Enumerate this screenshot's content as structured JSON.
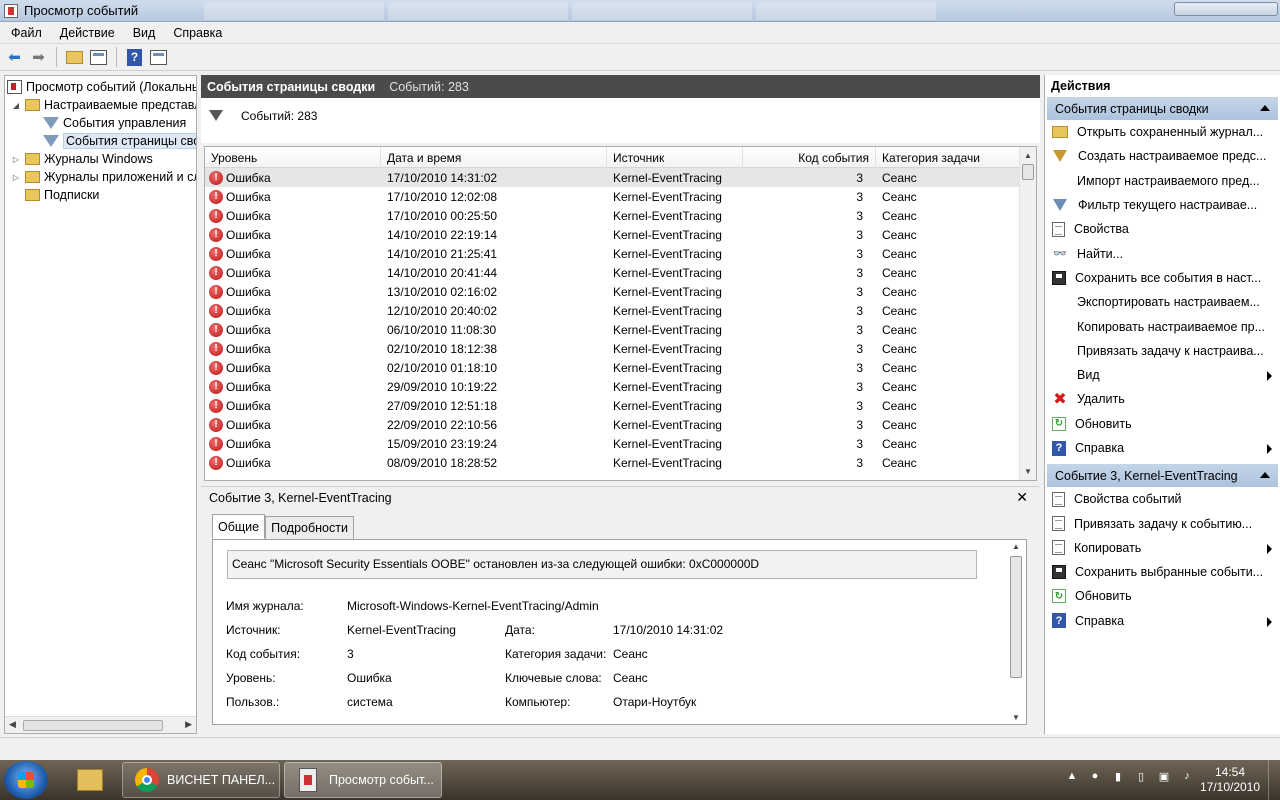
{
  "window": {
    "title": "Просмотр событий"
  },
  "menu": [
    "Файл",
    "Действие",
    "Вид",
    "Справка"
  ],
  "tree": {
    "items": [
      {
        "label": "Просмотр событий (Локальный)",
        "indent": 0,
        "icon": "event-viewer-icon",
        "expander": ""
      },
      {
        "label": "Настраиваемые представления",
        "indent": 1,
        "icon": "folder-icon",
        "expander": "◢"
      },
      {
        "label": "События управления",
        "indent": 2,
        "icon": "filter-icon",
        "expander": ""
      },
      {
        "label": "События страницы сводки",
        "indent": 2,
        "icon": "filter-icon",
        "expander": "",
        "selected": true
      },
      {
        "label": "Журналы Windows",
        "indent": 1,
        "icon": "folder-icon",
        "expander": "▷"
      },
      {
        "label": "Журналы приложений и служб",
        "indent": 1,
        "icon": "folder-icon",
        "expander": "▷"
      },
      {
        "label": "Подписки",
        "indent": 1,
        "icon": "folder-icon",
        "expander": ""
      }
    ]
  },
  "center": {
    "header_title": "События страницы сводки",
    "header_count": "Событий: 283",
    "filter_text": "Событий: 283",
    "columns": [
      "Уровень",
      "Дата и время",
      "Источник",
      "Код события",
      "Категория задачи"
    ],
    "rows": [
      [
        "Ошибка",
        "17/10/2010 14:31:02",
        "Kernel-EventTracing",
        "3",
        "Сеанс"
      ],
      [
        "Ошибка",
        "17/10/2010 12:02:08",
        "Kernel-EventTracing",
        "3",
        "Сеанс"
      ],
      [
        "Ошибка",
        "17/10/2010 00:25:50",
        "Kernel-EventTracing",
        "3",
        "Сеанс"
      ],
      [
        "Ошибка",
        "14/10/2010 22:19:14",
        "Kernel-EventTracing",
        "3",
        "Сеанс"
      ],
      [
        "Ошибка",
        "14/10/2010 21:25:41",
        "Kernel-EventTracing",
        "3",
        "Сеанс"
      ],
      [
        "Ошибка",
        "14/10/2010 20:41:44",
        "Kernel-EventTracing",
        "3",
        "Сеанс"
      ],
      [
        "Ошибка",
        "13/10/2010 02:16:02",
        "Kernel-EventTracing",
        "3",
        "Сеанс"
      ],
      [
        "Ошибка",
        "12/10/2010 20:40:02",
        "Kernel-EventTracing",
        "3",
        "Сеанс"
      ],
      [
        "Ошибка",
        "06/10/2010 11:08:30",
        "Kernel-EventTracing",
        "3",
        "Сеанс"
      ],
      [
        "Ошибка",
        "02/10/2010 18:12:38",
        "Kernel-EventTracing",
        "3",
        "Сеанс"
      ],
      [
        "Ошибка",
        "02/10/2010 01:18:10",
        "Kernel-EventTracing",
        "3",
        "Сеанс"
      ],
      [
        "Ошибка",
        "29/09/2010 10:19:22",
        "Kernel-EventTracing",
        "3",
        "Сеанс"
      ],
      [
        "Ошибка",
        "27/09/2010 12:51:18",
        "Kernel-EventTracing",
        "3",
        "Сеанс"
      ],
      [
        "Ошибка",
        "22/09/2010 22:10:56",
        "Kernel-EventTracing",
        "3",
        "Сеанс"
      ],
      [
        "Ошибка",
        "15/09/2010 23:19:24",
        "Kernel-EventTracing",
        "3",
        "Сеанс"
      ],
      [
        "Ошибка",
        "08/09/2010 18:28:52",
        "Kernel-EventTracing",
        "3",
        "Сеанс"
      ]
    ]
  },
  "detail": {
    "title": "Событие 3, Kernel-EventTracing",
    "close": "✕",
    "tabs": [
      "Общие",
      "Подробности"
    ],
    "message": "Сеанс \"Microsoft Security Essentials OOBE\" остановлен из-за следующей ошибки: 0xC000000D",
    "log_name_label": "Имя журнала:",
    "log_name_value": "Microsoft-Windows-Kernel-EventTracing/Admin",
    "source_label": "Источник:",
    "source_value": "Kernel-EventTracing",
    "date_label": "Дата:",
    "date_value": "17/10/2010 14:31:02",
    "event_id_label": "Код события:",
    "event_id_value": "3",
    "category_label": "Категория задачи:",
    "category_value": "Сеанс",
    "level_label": "Уровень:",
    "level_value": "Ошибка",
    "keywords_label": "Ключевые слова:",
    "keywords_value": "Сеанс",
    "user_label": "Пользов.:",
    "user_value": "система",
    "computer_label": "Компьютер:",
    "computer_value": "Отари-Ноутбук"
  },
  "actions": {
    "title": "Действия",
    "section1": "События страницы сводки",
    "items1": [
      {
        "label": "Открыть сохраненный журнал...",
        "icon": "open-log-icon",
        "submenu": false
      },
      {
        "label": "Создать настраиваемое предс...",
        "icon": "create-filter-icon",
        "submenu": false
      },
      {
        "label": "Импорт настраиваемого пред...",
        "icon": "blank",
        "submenu": false
      },
      {
        "label": "Фильтр текущего настраивае...",
        "icon": "filter-icon",
        "submenu": false
      },
      {
        "label": "Свойства",
        "icon": "properties-icon",
        "submenu": false
      },
      {
        "label": "Найти...",
        "icon": "find-icon",
        "submenu": false
      },
      {
        "label": "Сохранить все события в наст...",
        "icon": "save-icon",
        "submenu": false
      },
      {
        "label": "Экспортировать настраиваем...",
        "icon": "blank",
        "submenu": false
      },
      {
        "label": "Копировать настраиваемое пр...",
        "icon": "blank",
        "submenu": false
      },
      {
        "label": "Привязать задачу к настраива...",
        "icon": "blank",
        "submenu": false
      },
      {
        "label": "Вид",
        "icon": "blank",
        "submenu": true
      },
      {
        "label": "Удалить",
        "icon": "delete-icon",
        "submenu": false
      },
      {
        "label": "Обновить",
        "icon": "refresh-icon",
        "submenu": false
      },
      {
        "label": "Справка",
        "icon": "help-icon",
        "submenu": true
      }
    ],
    "section2": "Событие 3, Kernel-EventTracing",
    "items2": [
      {
        "label": "Свойства событий",
        "icon": "properties-icon",
        "submenu": false
      },
      {
        "label": "Привязать задачу к событию...",
        "icon": "attach-task-icon",
        "submenu": false
      },
      {
        "label": "Копировать",
        "icon": "copy-icon",
        "submenu": true
      },
      {
        "label": "Сохранить выбранные событи...",
        "icon": "save-icon",
        "submenu": false
      },
      {
        "label": "Обновить",
        "icon": "refresh-icon",
        "submenu": false
      },
      {
        "label": "Справка",
        "icon": "help-icon",
        "submenu": true
      }
    ]
  },
  "taskbar": {
    "chrome_label": "ВИСНЕТ ПАНЕЛ...",
    "eventviewer_label": "Просмотр событ...",
    "time": "14:54",
    "date": "17/10/2010"
  }
}
